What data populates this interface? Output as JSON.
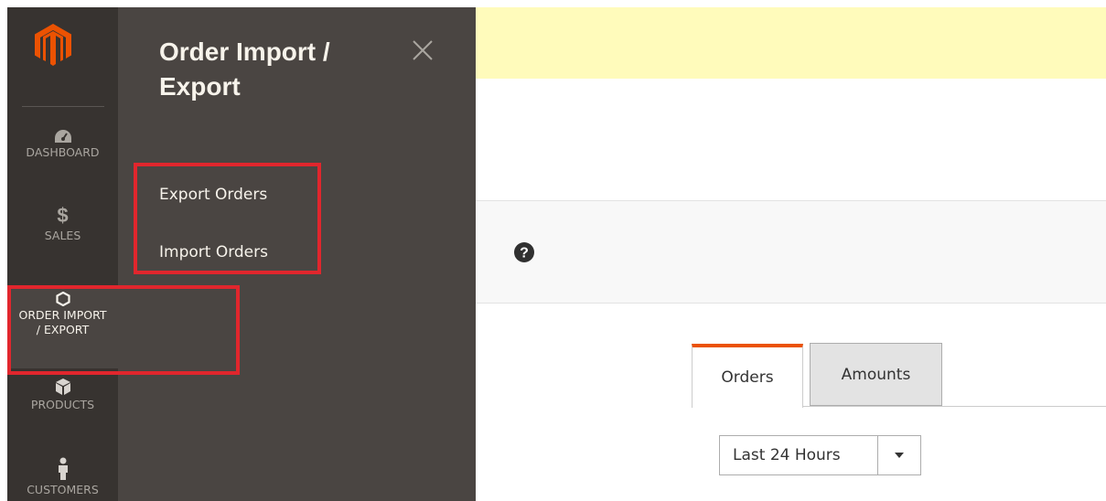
{
  "nav": {
    "items": [
      {
        "label": "DASHBOARD",
        "icon": "dashboard-icon"
      },
      {
        "label": "SALES",
        "icon": "dollar-icon"
      },
      {
        "label": "ORDER IMPORT / EXPORT",
        "label_line1": "ORDER IMPORT",
        "label_line2": "/ EXPORT",
        "icon": "hexagon-icon",
        "active": true
      },
      {
        "label": "PRODUCTS",
        "icon": "box-icon"
      },
      {
        "label": "CUSTOMERS",
        "icon": "person-icon"
      }
    ],
    "logo_icon": "magento-logo"
  },
  "flyout": {
    "title_line1": "Order Import /",
    "title_line2": "Export",
    "links": [
      "Export Orders",
      "Import Orders"
    ]
  },
  "dashboard": {
    "tabs": [
      {
        "label": "Orders",
        "active": true
      },
      {
        "label": "Amounts",
        "active": false
      }
    ],
    "period_select": {
      "value": "Last 24 Hours"
    }
  },
  "colors": {
    "nav_bg": "#373330",
    "flyout_bg": "#4a4542",
    "accent": "#eb5202",
    "highlight": "#e1262d",
    "notice_bg": "#fffbbb"
  }
}
